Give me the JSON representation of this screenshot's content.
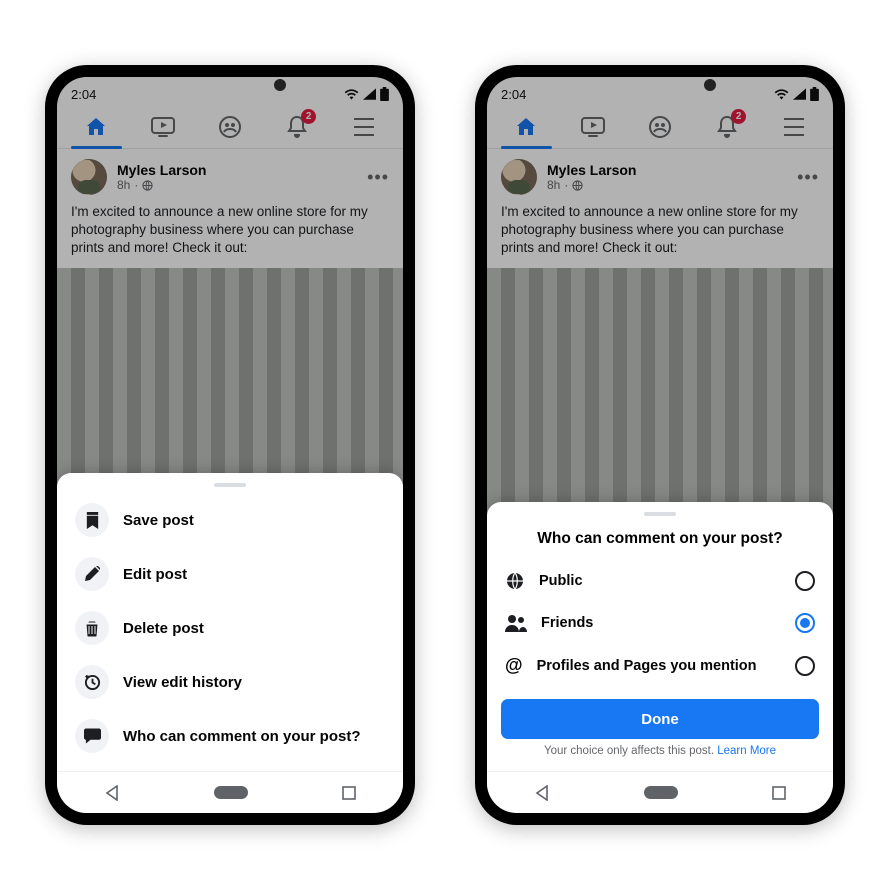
{
  "status": {
    "time": "2:04",
    "notification_badge": "2"
  },
  "post": {
    "author": "Myles Larson",
    "time": "8h",
    "audience_icon": "globe-icon",
    "text": "I'm excited to announce a new online store for my photography business where you can purchase prints and more! Check it out:"
  },
  "sheet_menu": {
    "items": [
      {
        "icon": "bookmark-icon",
        "label": "Save post"
      },
      {
        "icon": "pencil-icon",
        "label": "Edit post"
      },
      {
        "icon": "trash-icon",
        "label": "Delete post"
      },
      {
        "icon": "history-icon",
        "label": "View edit history"
      },
      {
        "icon": "comment-icon",
        "label": "Who can comment on your post?"
      }
    ]
  },
  "sheet_comment": {
    "title": "Who can comment on your post?",
    "options": [
      {
        "icon": "globe-icon",
        "label": "Public",
        "selected": false
      },
      {
        "icon": "friends-icon",
        "label": "Friends",
        "selected": true
      },
      {
        "icon": "mention-icon",
        "label": "Profiles and Pages you mention",
        "selected": false
      }
    ],
    "done": "Done",
    "footnote": "Your choice only affects this post.",
    "learn_more": "Learn More"
  }
}
